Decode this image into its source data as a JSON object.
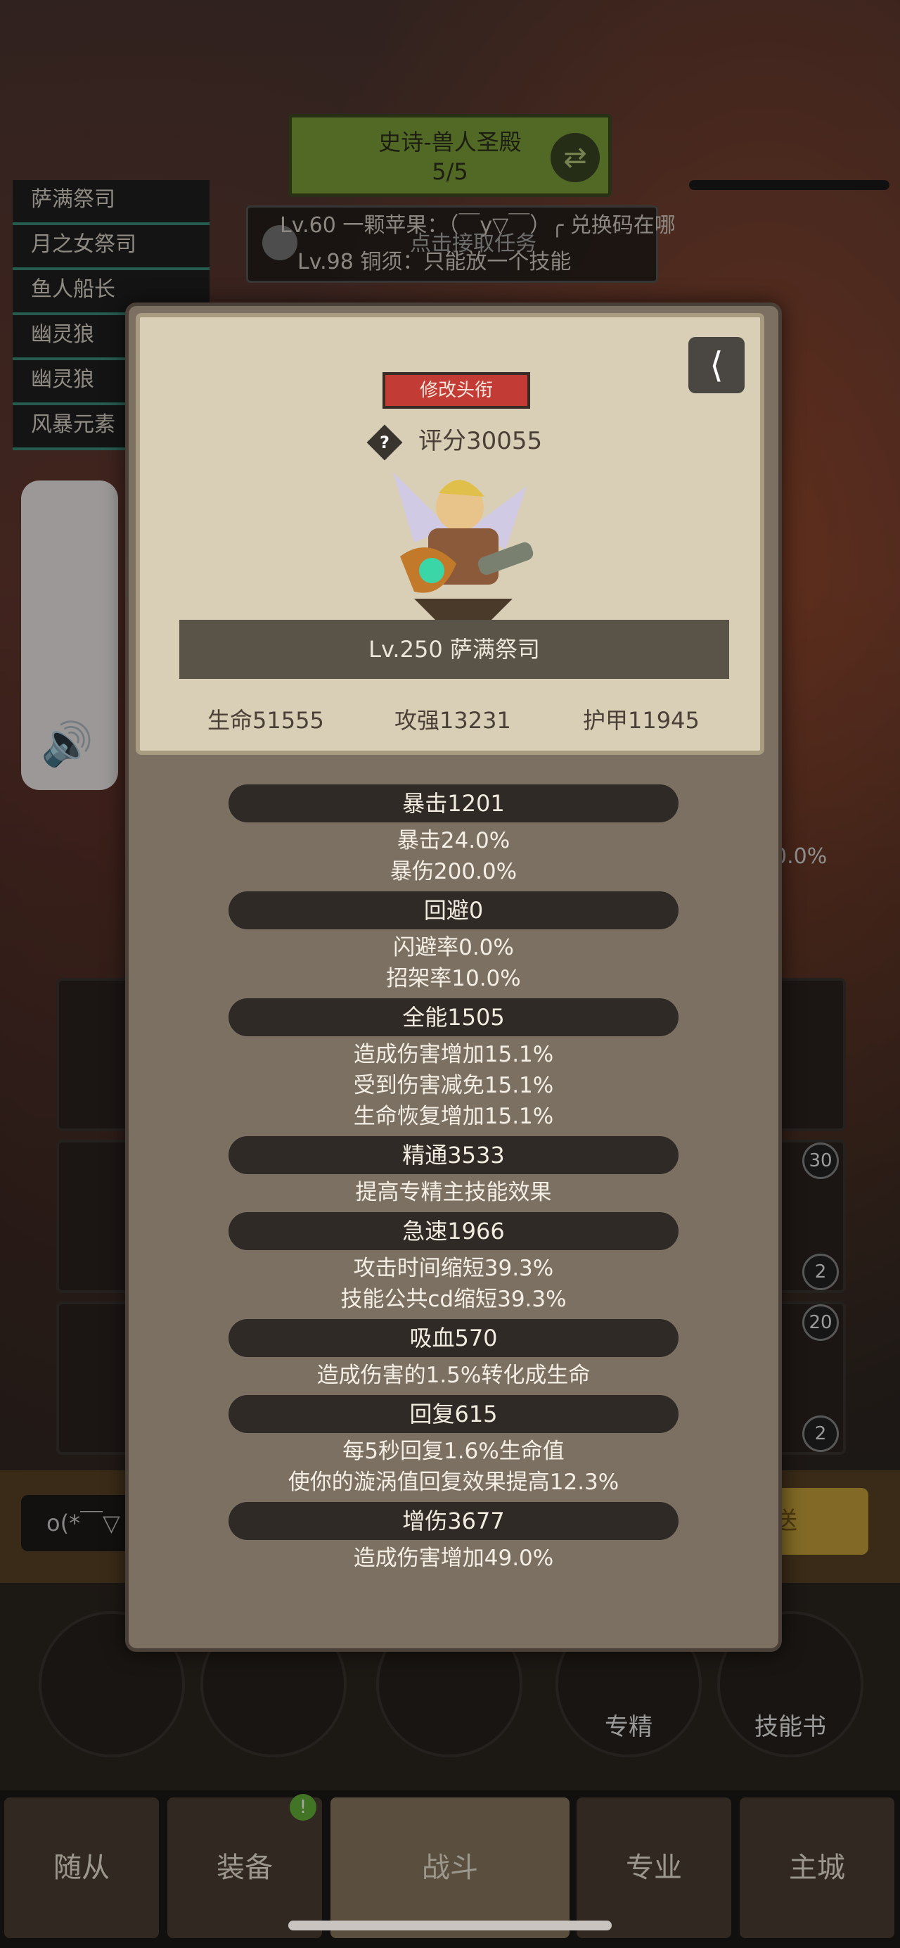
{
  "background": {
    "dungeon": {
      "title": "史诗-兽人圣殿",
      "progress": "5/5"
    },
    "quest": {
      "line1": "Lv.60 一颗苹果：（￣y▽￣）╭ 兑换码在哪",
      "line2": "Lv.98 铜须：只能放一个技能",
      "hint": "点击接取任务"
    },
    "team": [
      "萨满祭司",
      "月之女祭司",
      "鱼人船长",
      "幽灵狼",
      "幽灵狼",
      "风暴元素"
    ],
    "side_badges": [
      "30",
      "2",
      "20",
      "2"
    ],
    "side_percent": "0.0%",
    "chat": {
      "input_preview": "o(*￣▽",
      "send_label": "送"
    },
    "actions": [
      "专精",
      "技能书"
    ],
    "nav": {
      "tabs": [
        "随从",
        "装备",
        "战斗",
        "专业",
        "主城"
      ],
      "dot": "!"
    }
  },
  "modal": {
    "title_button": "修改头衔",
    "score_label": "评分30055",
    "hero_name": "Lv.250 萨满祭司",
    "main_stats": {
      "hp": "生命51555",
      "attack": "攻强13231",
      "armor": "护甲11945"
    },
    "sections": [
      {
        "header": "暴击1201",
        "lines": [
          "暴击24.0%",
          "暴伤200.0%"
        ]
      },
      {
        "header": "回避0",
        "lines": [
          "闪避率0.0%",
          "招架率10.0%"
        ]
      },
      {
        "header": "全能1505",
        "lines": [
          "造成伤害增加15.1%",
          "受到伤害减免15.1%",
          "生命恢复增加15.1%"
        ]
      },
      {
        "header": "精通3533",
        "lines": [
          "提高专精主技能效果"
        ]
      },
      {
        "header": "急速1966",
        "lines": [
          "攻击时间缩短39.3%",
          "技能公共cd缩短39.3%"
        ]
      },
      {
        "header": "吸血570",
        "lines": [
          "造成伤害的1.5%转化成生命"
        ]
      },
      {
        "header": "回复615",
        "lines": [
          "每5秒回复1.6%生命值",
          "使你的漩涡值回复效果提高12.3%"
        ]
      },
      {
        "header": "增伤3677",
        "lines": [
          "造成伤害增加49.0%"
        ]
      }
    ]
  },
  "colors": {
    "title_button": "#c23b35",
    "team_underline": "#3b8c7c",
    "dungeon": "#7fa13a"
  }
}
